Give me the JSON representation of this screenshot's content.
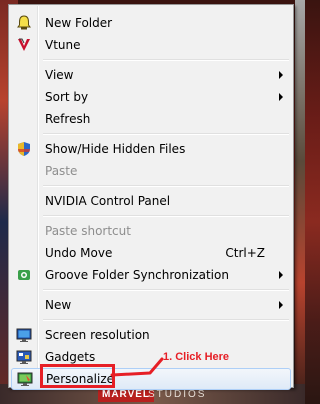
{
  "background": {
    "watermark": "MARVEL",
    "watermark2": "STUDIOS"
  },
  "menu": {
    "items": [
      {
        "label": "New Folder",
        "icon": "folder-bell-icon",
        "enabled": true
      },
      {
        "label": "Vtune",
        "icon": "vtune-icon",
        "enabled": true
      },
      {
        "label": "View",
        "submenu": true,
        "enabled": true
      },
      {
        "label": "Sort by",
        "submenu": true,
        "enabled": true
      },
      {
        "label": "Refresh",
        "enabled": true
      },
      {
        "label": "Show/Hide Hidden Files",
        "icon": "shield-icon",
        "enabled": true
      },
      {
        "label": "Paste",
        "enabled": false
      },
      {
        "label": "NVIDIA Control Panel",
        "enabled": true
      },
      {
        "label": "Paste shortcut",
        "enabled": false
      },
      {
        "label": "Undo Move",
        "shortcut": "Ctrl+Z",
        "enabled": true
      },
      {
        "label": "Groove Folder Synchronization",
        "icon": "groove-icon",
        "submenu": true,
        "enabled": true
      },
      {
        "label": "New",
        "submenu": true,
        "enabled": true
      },
      {
        "label": "Screen resolution",
        "icon": "monitor-icon",
        "enabled": true
      },
      {
        "label": "Gadgets",
        "icon": "gadgets-icon",
        "enabled": true
      },
      {
        "label": "Personalize",
        "icon": "personalize-icon",
        "enabled": true,
        "highlighted": true
      }
    ]
  },
  "annotation": {
    "text": "1. Click Here",
    "color": "#e61f26"
  }
}
